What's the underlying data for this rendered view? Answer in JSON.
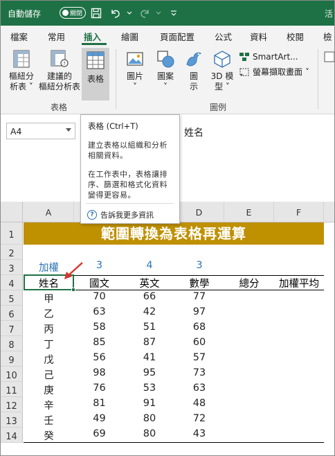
{
  "title_bar": {
    "autosave_label": "自動儲存",
    "autosave_state": "關閉",
    "right_text": "活",
    "accent": "#1e7145"
  },
  "ribbon_tabs": [
    "檔案",
    "常用",
    "插入",
    "繪圖",
    "頁面配置",
    "公式",
    "資料",
    "校閱",
    "檢"
  ],
  "active_tab": "插入",
  "ribbon": {
    "pivot_line1": "樞紐分",
    "pivot_line2": "析表",
    "rec_pivot_line1": "建議的",
    "rec_pivot_line2": "樞紐分析表",
    "table": "表格",
    "group_tables": "表格",
    "pictures": "圖片",
    "shapes": "圖案",
    "icons_line1": "圖",
    "icons_line2": "示",
    "models_line1": "3D 模",
    "models_line2": "型",
    "smartart": "SmartArt...",
    "screenshot": "螢幕擷取畫面",
    "group_illustrations": "圖例"
  },
  "formula_bar": {
    "name_box": "A4",
    "formula": "姓名"
  },
  "tooltip": {
    "title": "表格 (Ctrl+T)",
    "desc1": "建立表格以組織和分析相關資料。",
    "desc2": "在工作表中，表格讓排序、篩選和格式化資料變得更容易。",
    "link": "告訴我更多資訊"
  },
  "sheet": {
    "columns": [
      "A",
      "B",
      "C",
      "D",
      "E",
      "F"
    ],
    "rows": [
      "1",
      "2",
      "3",
      "4",
      "5",
      "6",
      "7",
      "8",
      "9",
      "10",
      "11",
      "12",
      "13",
      "14"
    ],
    "title": "範圍轉換為表格再運算",
    "weight_label": "加權",
    "weights": [
      "3",
      "4",
      "3"
    ],
    "headers": [
      "姓名",
      "國文",
      "英文",
      "數學",
      "總分",
      "加權平均"
    ],
    "data": [
      [
        "甲",
        "70",
        "66",
        "77"
      ],
      [
        "乙",
        "63",
        "42",
        "97"
      ],
      [
        "丙",
        "58",
        "51",
        "68"
      ],
      [
        "丁",
        "85",
        "87",
        "60"
      ],
      [
        "戊",
        "56",
        "41",
        "57"
      ],
      [
        "己",
        "98",
        "95",
        "73"
      ],
      [
        "庚",
        "76",
        "53",
        "63"
      ],
      [
        "辛",
        "81",
        "91",
        "48"
      ],
      [
        "壬",
        "49",
        "80",
        "72"
      ],
      [
        "癸",
        "69",
        "80",
        "43"
      ]
    ],
    "banner_color": "#bf9000",
    "weight_color": "#2e74b5"
  }
}
